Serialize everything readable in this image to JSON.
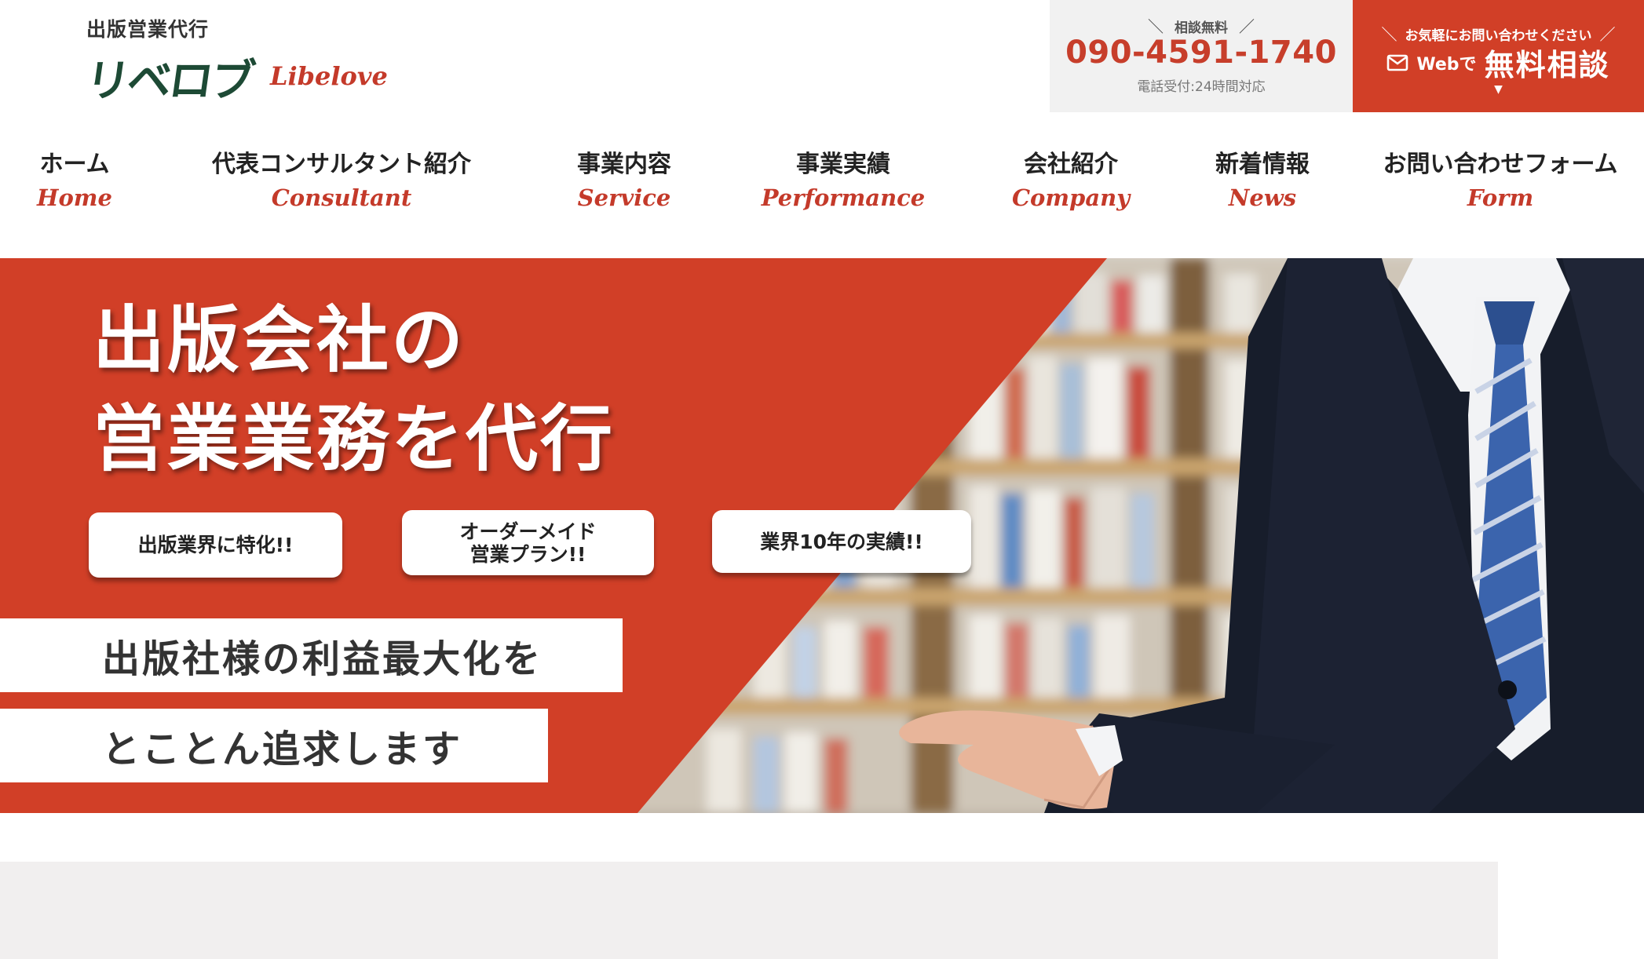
{
  "header": {
    "logo_sub": "出版営業代行",
    "logo_main": "リベロブ",
    "logo_en": "Libelove",
    "phone": {
      "top": "相談無料",
      "number": "090-4591-1740",
      "note": "電話受付:24時間対応"
    },
    "web": {
      "top": "お気軽にお問い合わせください",
      "small": "Webで",
      "big": "無料相談",
      "icon": "mail-icon"
    }
  },
  "nav": [
    {
      "jp": "ホーム",
      "en": "Home"
    },
    {
      "jp": "代表コンサルタント紹介",
      "en": "Consultant"
    },
    {
      "jp": "事業内容",
      "en": "Service"
    },
    {
      "jp": "事業実績",
      "en": "Performance"
    },
    {
      "jp": "会社紹介",
      "en": "Company"
    },
    {
      "jp": "新着情報",
      "en": "News"
    },
    {
      "jp": "お問い合わせフォーム",
      "en": "Form"
    }
  ],
  "hero": {
    "title_line1": "出版会社の",
    "title_line2": "営業業務を代行",
    "pills": [
      {
        "lines": [
          "出版業界に特化!!"
        ]
      },
      {
        "lines": [
          "オーダーメイド",
          "営業プラン!!"
        ]
      },
      {
        "lines": [
          "業界10年の実績!!"
        ]
      }
    ],
    "band1": "出版社様の利益最大化を",
    "band2": "とことん追求します"
  },
  "colors": {
    "accent_red": "#d13f27",
    "brand_green": "#1d4a35",
    "phone_bg": "#f1f1f1"
  }
}
